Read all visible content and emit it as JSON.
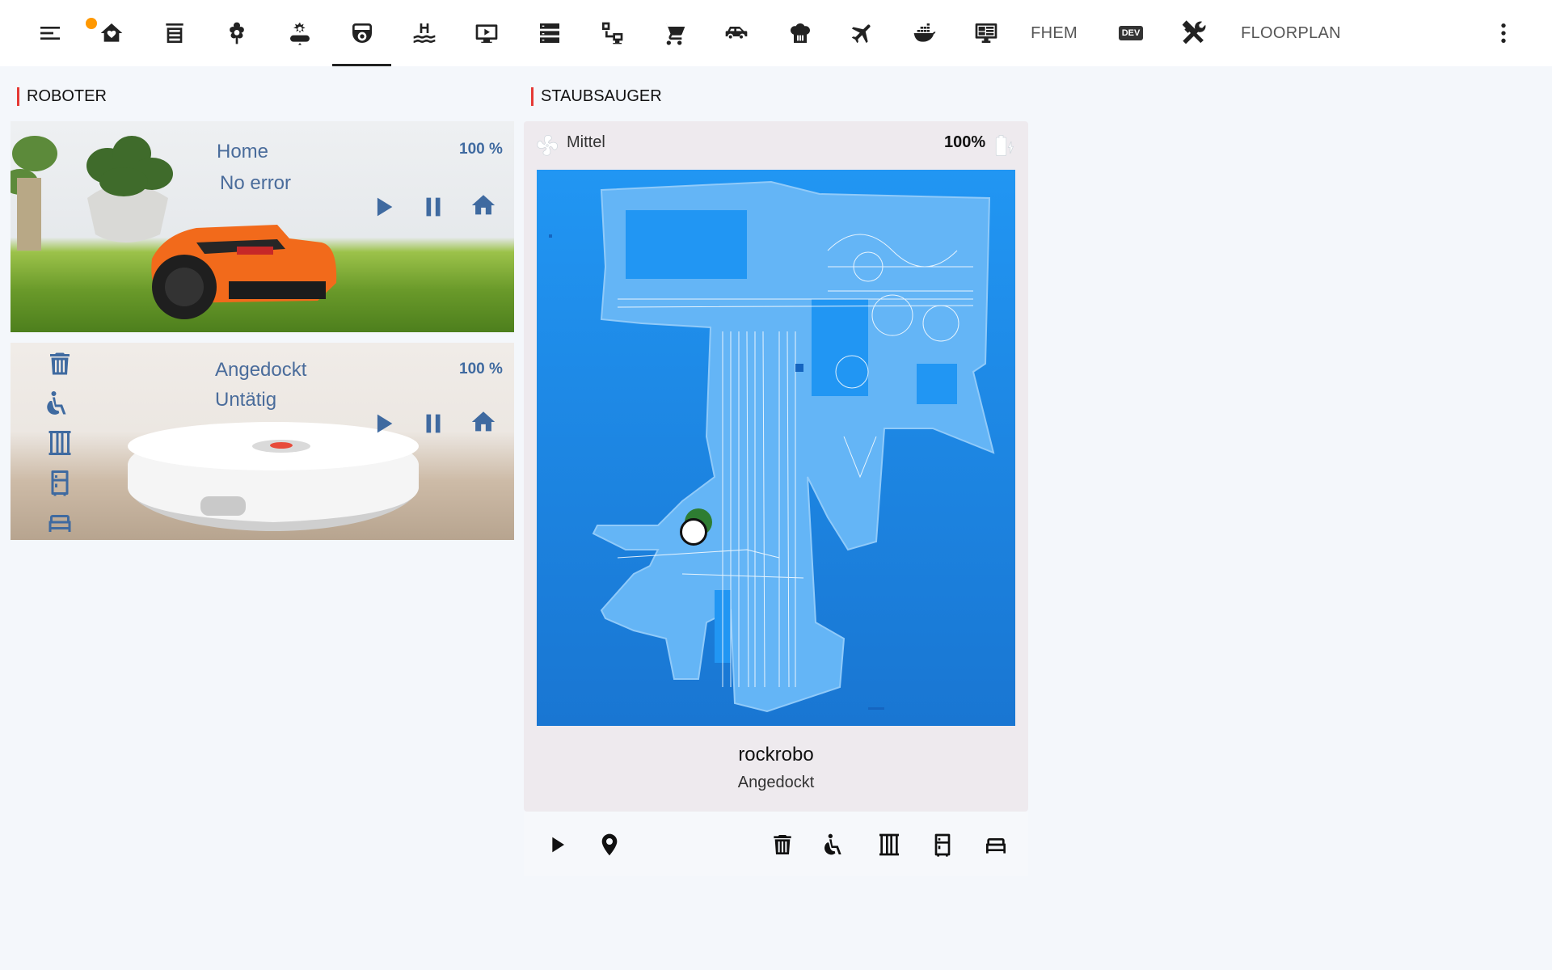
{
  "topbar": {
    "tabs": [
      {
        "icon": "menu-icon",
        "badge": true
      },
      {
        "icon": "home-heart-icon"
      },
      {
        "icon": "receipt-icon"
      },
      {
        "icon": "flower-icon"
      },
      {
        "icon": "weather-icon"
      },
      {
        "icon": "robot-vacuum-icon",
        "active": true
      },
      {
        "icon": "pool-icon"
      },
      {
        "icon": "media-play-icon"
      },
      {
        "icon": "server-icon"
      },
      {
        "icon": "network-icon"
      },
      {
        "icon": "cart-icon"
      },
      {
        "icon": "car-icon"
      },
      {
        "icon": "chef-hat-icon"
      },
      {
        "icon": "airplane-icon"
      },
      {
        "icon": "docker-icon"
      },
      {
        "icon": "monitor-dashboard-icon"
      }
    ],
    "fhem_label": "FHEM",
    "dev_label": "DEV",
    "floorplan_label": "FLOORPLAN"
  },
  "roboter": {
    "title": "ROBOTER",
    "mower": {
      "state": "Home",
      "error": "No error",
      "battery": "100 %"
    },
    "vacuum": {
      "state": "Angedockt",
      "status": "Untätig",
      "battery": "100 %"
    }
  },
  "staubsauger": {
    "title": "STAUBSAUGER",
    "fan_speed": "Mittel",
    "battery": "100%",
    "name": "rockrobo",
    "state": "Angedockt"
  },
  "colors": {
    "accent": "#3f6aa0",
    "map_blue": "#2196f3",
    "section_marker": "#e53935",
    "badge": "#ff9800"
  }
}
